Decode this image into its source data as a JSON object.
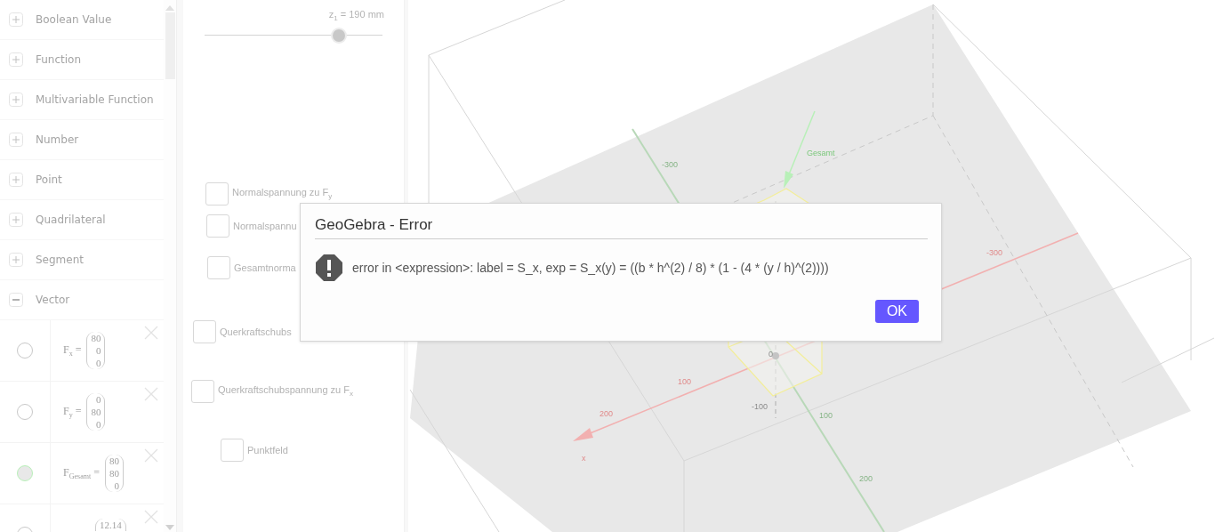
{
  "algebra": {
    "categories": [
      {
        "label": "Boolean Value",
        "expanded": false
      },
      {
        "label": "Function",
        "expanded": false
      },
      {
        "label": "Multivariable Function",
        "expanded": false
      },
      {
        "label": "Number",
        "expanded": false
      },
      {
        "label": "Point",
        "expanded": false
      },
      {
        "label": "Quadrilateral",
        "expanded": false
      },
      {
        "label": "Segment",
        "expanded": false
      },
      {
        "label": "Vector",
        "expanded": true
      }
    ],
    "vectors": [
      {
        "name": "F$_{x}$ =",
        "values": [
          "80",
          "0",
          "0"
        ],
        "visible": false
      },
      {
        "name": "F$_{y}$ =",
        "values": [
          "0",
          "80",
          "0"
        ],
        "visible": false
      },
      {
        "name": "F$_{Gesamt}$ =",
        "values": [
          "80",
          "80",
          "0"
        ],
        "visible": true
      },
      {
        "values": [
          "12.14"
        ],
        "visible": false
      }
    ]
  },
  "graphics": {
    "slider": {
      "label": "z$_{1}$ = 190 mm",
      "level": 0.755
    },
    "checkboxes": [
      {
        "label": "Normalspannung zu F$_{y}$",
        "checked": false
      },
      {
        "label": "Normalspannu",
        "checked": false
      },
      {
        "label": "Gesamtnorma",
        "checked": false
      },
      {
        "label": "Querkraftschubs",
        "checked": false
      },
      {
        "label": "Querkraftschubspannung zu F$_{x}$",
        "checked": false
      },
      {
        "label": "Punktfeld",
        "checked": false
      }
    ]
  },
  "graphics3d": {
    "labels": [
      {
        "text": "-300",
        "kind": "y"
      },
      {
        "text": "100",
        "kind": "y"
      },
      {
        "text": "200",
        "kind": "y"
      },
      {
        "text": "-300",
        "kind": "x"
      },
      {
        "text": "100",
        "kind": "x"
      },
      {
        "text": "200",
        "kind": "x"
      },
      {
        "text": "x",
        "kind": "x"
      },
      {
        "text": "0",
        "kind": "z"
      },
      {
        "text": "-100",
        "kind": "z"
      },
      {
        "text": "Gesamt",
        "kind": "vector"
      }
    ]
  },
  "dialog": {
    "title": "GeoGebra - Error",
    "message": "error in <expression>: label = S_x, exp = S_x(y) = ((b * h^(2) / 8) * (1 - (4 * (y / h)^(2))))",
    "button": "OK"
  }
}
